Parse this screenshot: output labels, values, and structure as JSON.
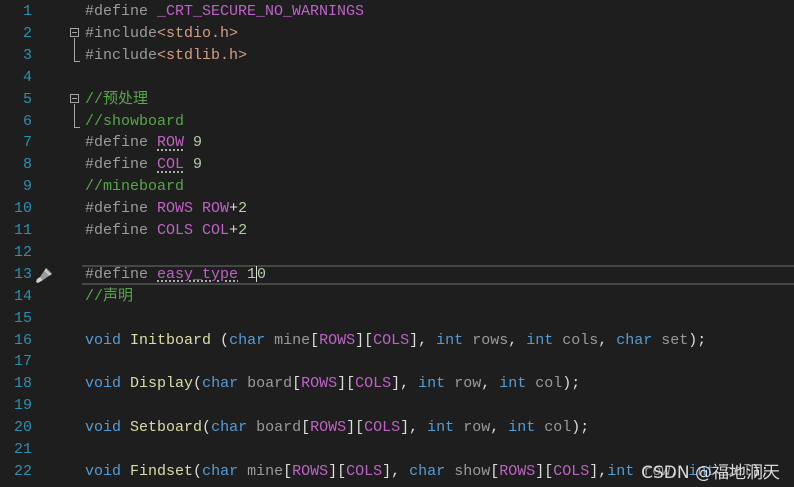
{
  "lines": [
    {
      "n": "1",
      "tokens": [
        [
          "pp",
          "#define "
        ],
        [
          "mac",
          "_CRT_SECURE_NO_WARNINGS"
        ]
      ]
    },
    {
      "n": "2",
      "tokens": [
        [
          "pp",
          "#include"
        ],
        [
          "str",
          "<stdio.h>"
        ]
      ]
    },
    {
      "n": "3",
      "tokens": [
        [
          "pp",
          "#include"
        ],
        [
          "str",
          "<stdlib.h>"
        ]
      ]
    },
    {
      "n": "4",
      "tokens": []
    },
    {
      "n": "5",
      "tokens": [
        [
          "cm",
          "//预处理"
        ]
      ]
    },
    {
      "n": "6",
      "tokens": [
        [
          "cm",
          "//showboard"
        ]
      ]
    },
    {
      "n": "7",
      "tokens": [
        [
          "pp",
          "#define "
        ],
        [
          "mac sq",
          "ROW"
        ],
        [
          "num",
          " 9"
        ]
      ]
    },
    {
      "n": "8",
      "tokens": [
        [
          "pp",
          "#define "
        ],
        [
          "mac sq",
          "COL"
        ],
        [
          "num",
          " 9"
        ]
      ]
    },
    {
      "n": "9",
      "tokens": [
        [
          "cm",
          "//mineboard"
        ]
      ]
    },
    {
      "n": "10",
      "tokens": [
        [
          "pp",
          "#define "
        ],
        [
          "mac",
          "ROWS"
        ],
        [
          "tx",
          " "
        ],
        [
          "mac",
          "ROW"
        ],
        [
          "tx",
          "+"
        ],
        [
          "num",
          "2"
        ]
      ]
    },
    {
      "n": "11",
      "tokens": [
        [
          "pp",
          "#define "
        ],
        [
          "mac",
          "COLS"
        ],
        [
          "tx",
          " "
        ],
        [
          "mac",
          "COL"
        ],
        [
          "tx",
          "+"
        ],
        [
          "num",
          "2"
        ]
      ]
    },
    {
      "n": "12",
      "tokens": []
    },
    {
      "n": "13",
      "tokens": [
        [
          "pp",
          "#define "
        ],
        [
          "mac sq",
          "easy_type"
        ],
        [
          "num",
          " 1"
        ],
        [
          "caret",
          ""
        ],
        [
          "num",
          "0"
        ]
      ]
    },
    {
      "n": "14",
      "tokens": [
        [
          "cm",
          "//声明"
        ]
      ]
    },
    {
      "n": "15",
      "tokens": []
    },
    {
      "n": "16",
      "tokens": [
        [
          "kw",
          "void"
        ],
        [
          "tx",
          " "
        ],
        [
          "fn",
          "Initboard"
        ],
        [
          "tx",
          " ("
        ],
        [
          "kw",
          "char"
        ],
        [
          "pm",
          " mine"
        ],
        [
          "tx",
          "["
        ],
        [
          "mac",
          "ROWS"
        ],
        [
          "tx",
          "]["
        ],
        [
          "mac",
          "COLS"
        ],
        [
          "tx",
          "], "
        ],
        [
          "kw",
          "int"
        ],
        [
          "pm",
          " rows"
        ],
        [
          "tx",
          ", "
        ],
        [
          "kw",
          "int"
        ],
        [
          "pm",
          " cols"
        ],
        [
          "tx",
          ", "
        ],
        [
          "kw",
          "char"
        ],
        [
          "pm",
          " set"
        ],
        [
          "tx",
          ");"
        ]
      ]
    },
    {
      "n": "17",
      "tokens": []
    },
    {
      "n": "18",
      "tokens": [
        [
          "kw",
          "void"
        ],
        [
          "tx",
          " "
        ],
        [
          "fn",
          "Display"
        ],
        [
          "tx",
          "("
        ],
        [
          "kw",
          "char"
        ],
        [
          "pm",
          " board"
        ],
        [
          "tx",
          "["
        ],
        [
          "mac",
          "ROWS"
        ],
        [
          "tx",
          "]["
        ],
        [
          "mac",
          "COLS"
        ],
        [
          "tx",
          "], "
        ],
        [
          "kw",
          "int"
        ],
        [
          "pm",
          " row"
        ],
        [
          "tx",
          ", "
        ],
        [
          "kw",
          "int"
        ],
        [
          "pm",
          " col"
        ],
        [
          "tx",
          ");"
        ]
      ]
    },
    {
      "n": "19",
      "tokens": []
    },
    {
      "n": "20",
      "tokens": [
        [
          "kw",
          "void"
        ],
        [
          "tx",
          " "
        ],
        [
          "fn",
          "Setboard"
        ],
        [
          "tx",
          "("
        ],
        [
          "kw",
          "char"
        ],
        [
          "pm",
          " board"
        ],
        [
          "tx",
          "["
        ],
        [
          "mac",
          "ROWS"
        ],
        [
          "tx",
          "]["
        ],
        [
          "mac",
          "COLS"
        ],
        [
          "tx",
          "], "
        ],
        [
          "kw",
          "int"
        ],
        [
          "pm",
          " row"
        ],
        [
          "tx",
          ", "
        ],
        [
          "kw",
          "int"
        ],
        [
          "pm",
          " col"
        ],
        [
          "tx",
          ");"
        ]
      ]
    },
    {
      "n": "21",
      "tokens": []
    },
    {
      "n": "22",
      "tokens": [
        [
          "kw",
          "void"
        ],
        [
          "tx",
          " "
        ],
        [
          "fn",
          "Findset"
        ],
        [
          "tx",
          "("
        ],
        [
          "kw",
          "char"
        ],
        [
          "pm",
          " mine"
        ],
        [
          "tx",
          "["
        ],
        [
          "mac",
          "ROWS"
        ],
        [
          "tx",
          "]["
        ],
        [
          "mac",
          "COLS"
        ],
        [
          "tx",
          "], "
        ],
        [
          "kw",
          "char"
        ],
        [
          "pm",
          " show"
        ],
        [
          "tx",
          "["
        ],
        [
          "mac",
          "ROWS"
        ],
        [
          "tx",
          "]["
        ],
        [
          "mac",
          "COLS"
        ],
        [
          "tx",
          "],"
        ],
        [
          "kw",
          "int"
        ],
        [
          "pm",
          " row"
        ],
        [
          "tx",
          ", "
        ],
        [
          "kw",
          "int"
        ],
        [
          "pm",
          " col"
        ],
        [
          "tx",
          ");"
        ]
      ]
    }
  ],
  "current_line": "13",
  "gutter_icon": "paintbrush-icon",
  "watermark": "CSDN @福地洞天"
}
